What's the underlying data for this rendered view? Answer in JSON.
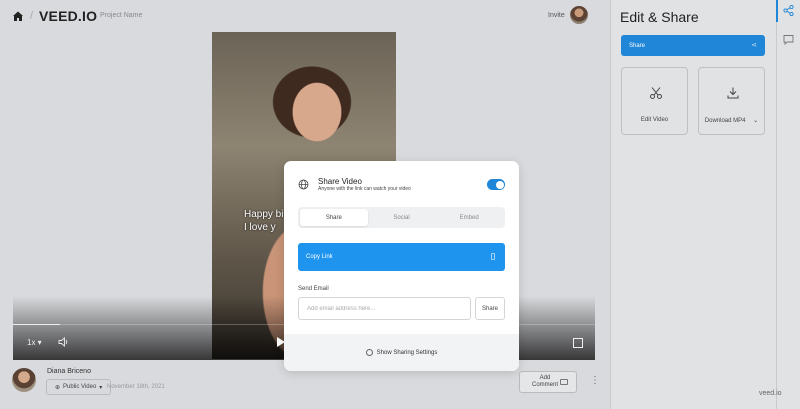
{
  "header": {
    "logo": "VEED.IO",
    "separator": "/",
    "project_name": "Project Name",
    "invite_label": "Invite"
  },
  "video": {
    "caption_line1": "Happy bi",
    "caption_line2": "I love y",
    "speed": "1x",
    "progress_fraction": 0.08
  },
  "meta": {
    "author": "Diana Briceno",
    "visibility": "Public Video",
    "date": "November 18th, 2021",
    "add_comment": "Add Comment",
    "more": "⋮"
  },
  "panel": {
    "title": "Edit & Share",
    "share_label": "Share",
    "cards": [
      {
        "label": "Edit Video",
        "icon": "scissors-icon"
      },
      {
        "label": "Download MP4",
        "icon": "download-icon"
      }
    ]
  },
  "modal": {
    "title": "Share Video",
    "subtitle": "Anyone with the link can watch your video",
    "public_enabled": true,
    "tabs": [
      "Share",
      "Social",
      "Embed"
    ],
    "active_tab": 0,
    "copy_link": "Copy Link",
    "email_label": "Send Email",
    "email_placeholder": "Add email address here...",
    "email_share": "Share",
    "footer": "Show Sharing Settings"
  },
  "watermark": "veed.io",
  "colors": {
    "accent": "#1f86d8",
    "copy_button": "#1f94ef",
    "background": "#d9dadd"
  }
}
